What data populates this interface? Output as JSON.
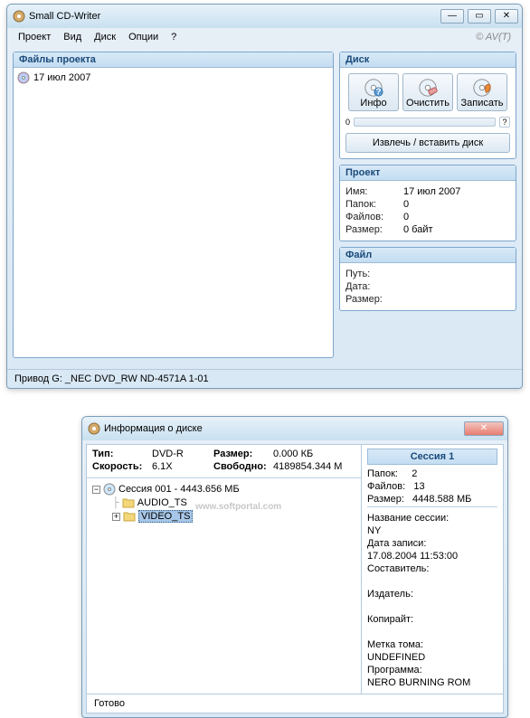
{
  "window1": {
    "title": "Small CD-Writer",
    "menu": {
      "proekt": "Проект",
      "vid": "Вид",
      "disk": "Диск",
      "optsii": "Опции",
      "help": "?"
    },
    "avt": "© AV(T)",
    "files_header": "Файлы проекта",
    "file_item": "17 июл 2007",
    "disc": {
      "header": "Диск",
      "info": "Инфо",
      "clear": "Очистить",
      "write": "Записать",
      "progress_value": "0",
      "eject": "Извлечь / вставить диск"
    },
    "project": {
      "header": "Проект",
      "name_label": "Имя:",
      "name_value": "17 июл 2007",
      "folders_label": "Папок:",
      "folders_value": "0",
      "files_label": "Файлов:",
      "files_value": "0",
      "size_label": "Размер:",
      "size_value": "0 байт"
    },
    "file": {
      "header": "Файл",
      "path_label": "Путь:",
      "path_value": "",
      "date_label": "Дата:",
      "date_value": "",
      "size_label": "Размер:",
      "size_value": ""
    },
    "drive_line": "Привод  G: _NEC DVD_RW ND-4571A 1-01"
  },
  "window2": {
    "title": "Информация о диске",
    "type_label": "Тип:",
    "type_value": "DVD-R",
    "speed_label": "Скорость:",
    "speed_value": "6.1X",
    "size_label": "Размер:",
    "size_value": "0.000 КБ",
    "free_label": "Свободно:",
    "free_value": "4189854.344 М",
    "tree": {
      "session": "Сессия 001 - 4443.656 МБ",
      "audio": "AUDIO_TS",
      "video": "VIDEO_TS"
    },
    "session": {
      "header": "Сессия 1",
      "folders_label": "Папок:",
      "folders_value": "2",
      "files_label": "Файлов:",
      "files_value": "13",
      "size_label": "Размер:",
      "size_value": "4448.588 МБ",
      "name_label": "Название сессии:",
      "name_value": "NY",
      "date_label": "Дата записи:",
      "date_value": "17.08.2004 11:53:00",
      "author_label": "Составитель:",
      "author_value": "",
      "publisher_label": "Издатель:",
      "publisher_value": "",
      "copyright_label": "Копирайт:",
      "copyright_value": "",
      "volume_label": "Метка тома:",
      "volume_value": "UNDEFINED",
      "program_label": "Программа:",
      "program_value": "NERO BURNING ROM"
    },
    "status": "Готово",
    "watermark": "www.softportal.com"
  }
}
